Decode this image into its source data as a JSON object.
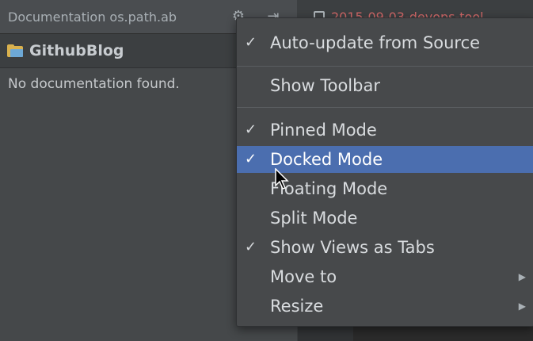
{
  "tool_window": {
    "title": "Documentation os.path.ab",
    "icons": [
      "gear-icon",
      "pin-icon"
    ]
  },
  "breadcrumb": {
    "label": "GithubBlog"
  },
  "documentation": {
    "message": "No documentation found."
  },
  "editor": {
    "tab_label": "2015-09-03-devops-tool"
  },
  "context_menu": {
    "items": [
      {
        "label": "Auto-update from Source",
        "checked": true
      },
      {
        "label": "Show Toolbar",
        "checked": false
      },
      {
        "label": "Pinned Mode",
        "checked": true
      },
      {
        "label": "Docked Mode",
        "checked": true,
        "selected": true
      },
      {
        "label": "Floating Mode",
        "checked": false
      },
      {
        "label": "Split Mode",
        "checked": false
      },
      {
        "label": "Show Views as Tabs",
        "checked": true
      },
      {
        "label": "Move to",
        "checked": false,
        "submenu": true
      },
      {
        "label": "Resize",
        "checked": false,
        "submenu": true
      }
    ],
    "check_glyph": "✓",
    "submenu_glyph": "▶"
  },
  "colors": {
    "selection": "#4b6eaf",
    "panel_bg": "#3c3f41",
    "menu_bg": "#47494b"
  }
}
